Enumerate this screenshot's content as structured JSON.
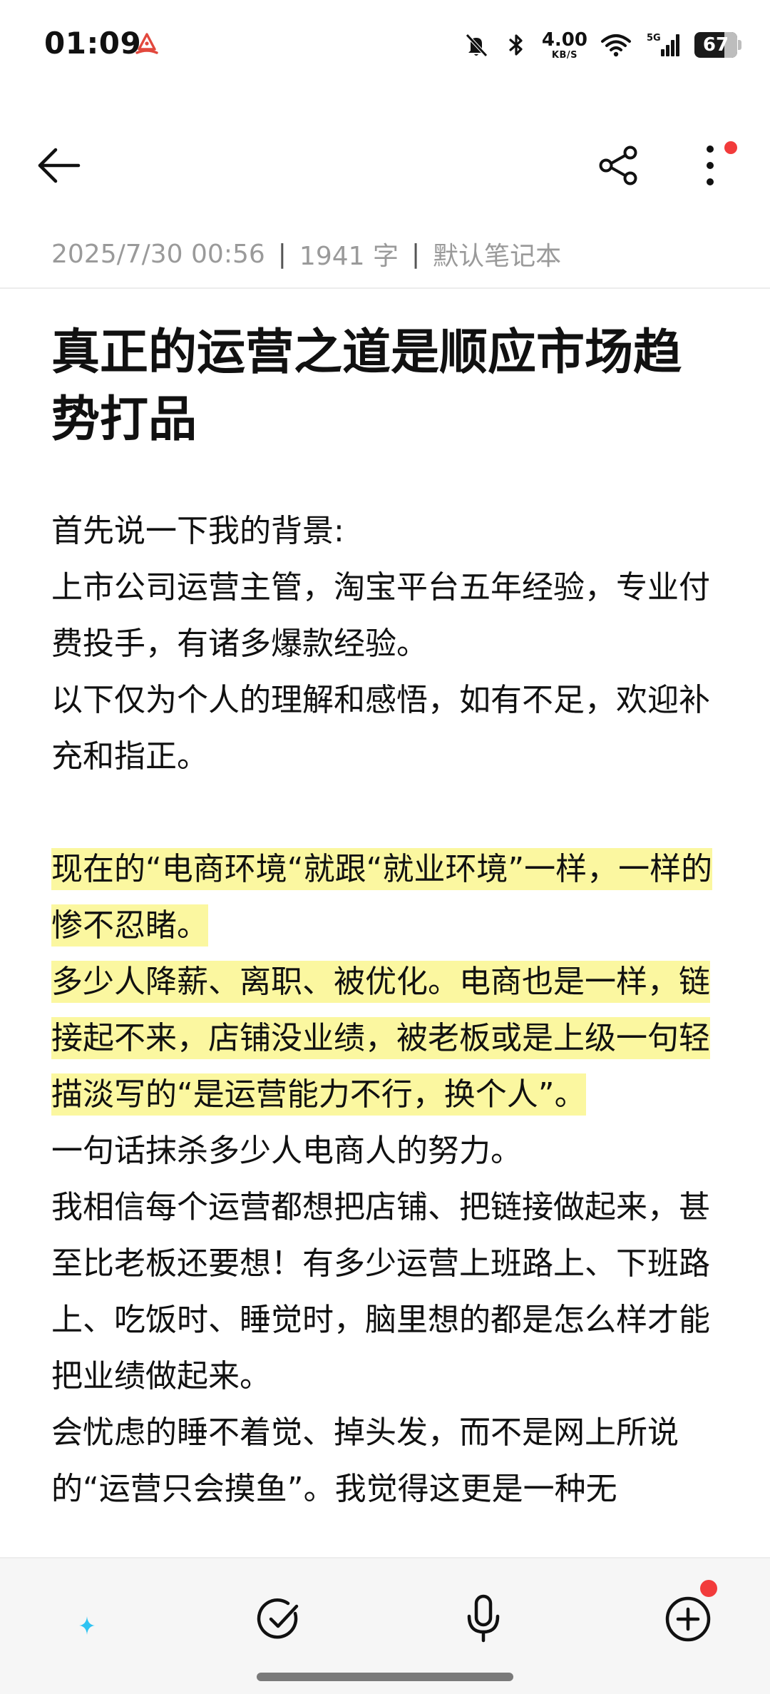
{
  "status_bar": {
    "time": "01:09",
    "net_speed_value": "4.00",
    "net_speed_unit": "KB/S",
    "network_label": "5G",
    "battery_level": "67"
  },
  "toolbar": {
    "back_icon": "arrow-left-icon",
    "share_icon": "share-icon",
    "more_icon": "more-vertical-icon",
    "notification_dot_color": "#f23b3b"
  },
  "meta": {
    "datetime": "2025/7/30 00:56",
    "word_count": "1941 字",
    "notebook": "默认笔记本",
    "separator": "|"
  },
  "note": {
    "title": "真正的运营之道是顺应市场趋势打品",
    "body_lines": {
      "p1": "首先说一下我的背景:",
      "p2": "上市公司运营主管，淘宝平台五年经验，专业付费投手，有诸多爆款经验。",
      "p3": "以下仅为个人的理解和感悟，如有不足，欢迎补充和指正。",
      "h1": "现在的“电商环境“就跟“就业环境”一样，一样的惨不忍睹。",
      "h2": "多少人降薪、离职、被优化。电商也是一样，链接起不来，店铺没业绩，被老板或是上级一句轻描淡写的“是运营能力不行，换个人”。",
      "p4": "一句话抹杀多少人电商人的努力。",
      "p5": "我相信每个运营都想把店铺、把链接做起来，甚至比老板还要想！有多少运营上班路上、下班路上、吃饭时、睡觉时，脑里想的都是怎么样才能把业绩做起来。",
      "p6": "会忧虑的睡不着觉、掉头发，而不是网上所说的“运营只会摸鱼”。我觉得这更是一种无"
    },
    "highlight_color": "#fbf7a0"
  },
  "bottom_bar": {
    "items": [
      {
        "icon": "ai-format-icon"
      },
      {
        "icon": "checklist-icon"
      },
      {
        "icon": "microphone-icon"
      },
      {
        "icon": "add-circle-icon"
      }
    ]
  }
}
